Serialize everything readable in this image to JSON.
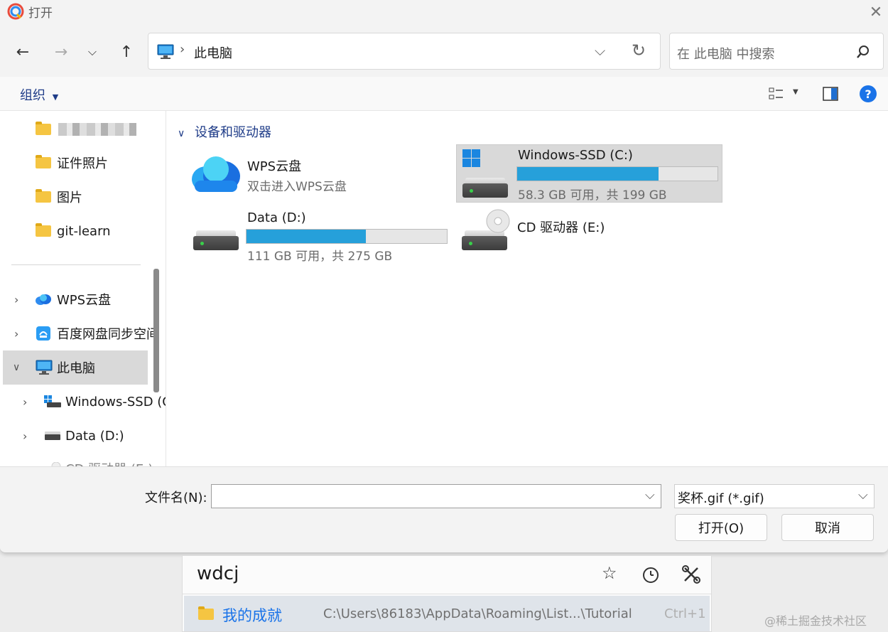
{
  "titlebar": {
    "title": "打开"
  },
  "address": {
    "path": "此电脑"
  },
  "search": {
    "placeholder": "在 此电脑 中搜索"
  },
  "toolbar": {
    "organize": "组织"
  },
  "sidebar": {
    "items": [
      {
        "label": "证件照片"
      },
      {
        "label": "图片"
      },
      {
        "label": "git-learn"
      },
      {
        "label": "WPS云盘"
      },
      {
        "label": "百度网盘同步空间"
      },
      {
        "label": "此电脑"
      },
      {
        "label": "Windows-SSD (C:)"
      },
      {
        "label": "Data (D:)"
      },
      {
        "label": "CD 驱动器 (E:)"
      }
    ]
  },
  "section": {
    "title": "设备和驱动器"
  },
  "drives": {
    "wps": {
      "name": "WPS云盘",
      "subtitle": "双击进入WPS云盘"
    },
    "c": {
      "name": "Windows-SSD (C:)",
      "info": "58.3 GB 可用，共 199 GB",
      "used_fraction": 0.707
    },
    "d": {
      "name": "Data (D:)",
      "info": "111 GB 可用，共 275 GB",
      "used_fraction": 0.596
    },
    "e": {
      "name": "CD 驱动器 (E:)"
    }
  },
  "bottom": {
    "filename_label": "文件名(N):",
    "filename_value": "",
    "filetype": "奖杯.gif (*.gif)",
    "open_button": "打开(O)",
    "cancel_button": "取消"
  },
  "launcher": {
    "query": "wdcj",
    "result": {
      "title": "我的成就",
      "path": "C:\\Users\\86183\\AppData\\Roaming\\List...\\Tutorial",
      "shortcut": "Ctrl+1"
    }
  },
  "watermark": "@稀土掘金技术社区",
  "colors": {
    "accent": "#26a0da",
    "selection": "#d9d9d9",
    "link": "#1a73e8"
  }
}
